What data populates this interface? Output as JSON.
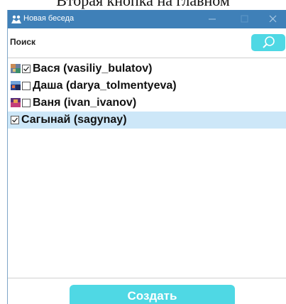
{
  "caption": {
    "text": "Вторая кнопка на главном"
  },
  "window": {
    "title": "Новая беседа",
    "icon": "app-person-icon",
    "controls": [
      "minimize-icon",
      "maximize-icon",
      "close-icon"
    ]
  },
  "search": {
    "placeholder": "Поиск",
    "value": "",
    "icon": "search-icon"
  },
  "contacts": [
    {
      "label": "Вася (vasiliy_bulatov)",
      "checked": true,
      "has_avatar": true,
      "selected": false
    },
    {
      "label": "Даша (darya_tolmentyeva)",
      "checked": false,
      "has_avatar": true,
      "selected": false
    },
    {
      "label": "Ваня (ivan_ivanov)",
      "checked": false,
      "has_avatar": true,
      "selected": false
    },
    {
      "label": "Сагынай (sagynay)",
      "checked": true,
      "has_avatar": false,
      "selected": true
    }
  ],
  "create_button": {
    "label": "Создать"
  },
  "colors": {
    "titlebar": "#3f80b8",
    "accent": "#4fd8e4",
    "selected_row": "#cde7f8",
    "button_text": "#ffffff"
  }
}
